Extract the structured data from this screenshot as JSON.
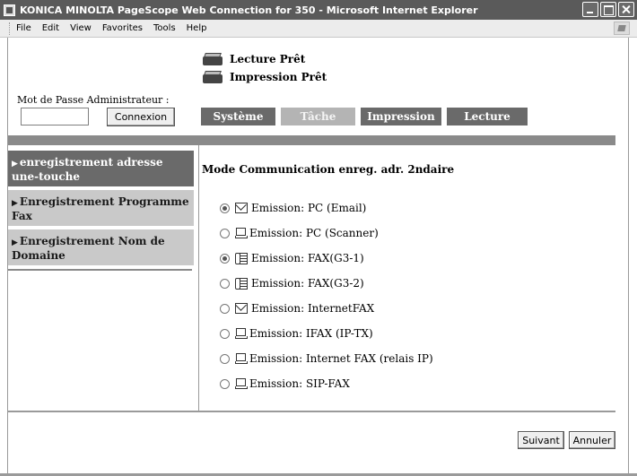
{
  "window": {
    "title": "KONICA MINOLTA PageScope Web Connection for 350 - Microsoft Internet Explorer"
  },
  "menu": [
    "File",
    "Edit",
    "View",
    "Favorites",
    "Tools",
    "Help"
  ],
  "status": {
    "scan": "Lecture Prêt",
    "print": "Impression Prêt"
  },
  "admin": {
    "label": "Mot de Passe Administrateur :",
    "password_value": "",
    "login_button": "Connexion"
  },
  "tabs": [
    {
      "label": "Système",
      "active": false
    },
    {
      "label": "Tâche",
      "active": true
    },
    {
      "label": "Impression",
      "active": false
    },
    {
      "label": "Lecture",
      "active": false
    }
  ],
  "sidebar": {
    "items": [
      {
        "label": "enregistrement adresse une-touche",
        "active": true
      },
      {
        "label": "Enregistrement Programme Fax",
        "active": false
      },
      {
        "label": "Enregistrement Nom de Domaine",
        "active": false
      }
    ]
  },
  "main": {
    "title": "Mode Communication enreg. adr. 2ndaire",
    "options": [
      {
        "label": "Emission: PC (Email)",
        "icon": "email-icon",
        "checked": true
      },
      {
        "label": "Emission: PC (Scanner)",
        "icon": "pc-icon",
        "checked": false
      },
      {
        "label": "Emission: FAX(G3-1)",
        "icon": "fax-icon",
        "checked": true
      },
      {
        "label": "Emission: FAX(G3-2)",
        "icon": "fax-icon",
        "checked": false
      },
      {
        "label": "Emission: InternetFAX",
        "icon": "email-icon",
        "checked": false
      },
      {
        "label": "Emission: IFAX (IP-TX)",
        "icon": "pc-icon",
        "checked": false
      },
      {
        "label": "Emission: Internet FAX (relais IP)",
        "icon": "pc-icon",
        "checked": false
      },
      {
        "label": "Emission: SIP-FAX",
        "icon": "pc-icon",
        "checked": false
      }
    ]
  },
  "footer": {
    "next_button": "Suivant",
    "cancel_button": "Annuler"
  }
}
